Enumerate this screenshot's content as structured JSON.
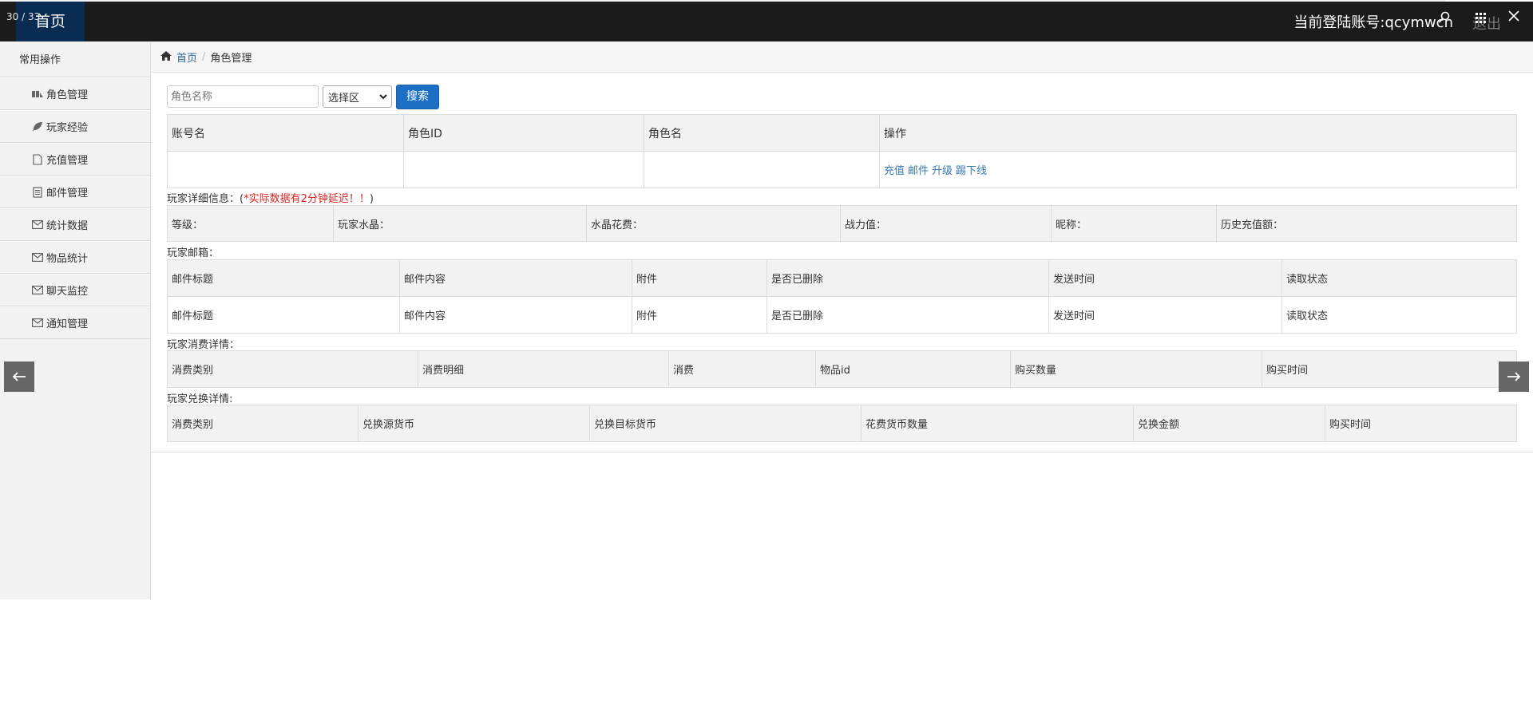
{
  "topbar": {
    "counter": "30 / 33",
    "home_tab": "首页",
    "account": "当前登陆账号:qcymwcn",
    "logout": "退出"
  },
  "sidebar": {
    "title": "常用操作",
    "items": [
      {
        "label": "角色管理",
        "icon": "users-icon"
      },
      {
        "label": "玩家经验",
        "icon": "leaf-icon"
      },
      {
        "label": "充值管理",
        "icon": "file-icon"
      },
      {
        "label": "邮件管理",
        "icon": "list-icon"
      },
      {
        "label": "统计数据",
        "icon": "envelope-icon"
      },
      {
        "label": "物品统计",
        "icon": "envelope-icon"
      },
      {
        "label": "聊天监控",
        "icon": "envelope-icon"
      },
      {
        "label": "通知管理",
        "icon": "envelope-icon"
      }
    ]
  },
  "breadcrumb": {
    "home": "首页",
    "current": "角色管理"
  },
  "search": {
    "placeholder": "角色名称",
    "select_value": "选择区",
    "button": "搜索"
  },
  "role_table": {
    "headers": [
      "账号名",
      "角色ID",
      "角色名",
      "操作"
    ],
    "actions": [
      "充值",
      "邮件",
      "升级",
      "踢下线"
    ]
  },
  "detail": {
    "label": "玩家详细信息：(",
    "warning": "*实际数据有2分钟延迟！！",
    "label_end": ")",
    "fields": [
      "等级：",
      "玩家水晶：",
      "水晶花费：",
      "战力值：",
      "昵称：",
      "历史充值额："
    ]
  },
  "mailbox": {
    "label": "玩家邮箱：",
    "headers": [
      "邮件标题",
      "邮件内容",
      "附件",
      "是否已删除",
      "发送时间",
      "读取状态"
    ],
    "row": [
      "邮件标题",
      "邮件内容",
      "附件",
      "是否已删除",
      "发送时间",
      "读取状态"
    ]
  },
  "consume": {
    "label": "玩家消费详情：",
    "headers": [
      "消费类别",
      "消费明细",
      "消费",
      "物品id",
      "购买数量",
      "购买时间"
    ]
  },
  "exchange": {
    "label": "玩家兑换详情:",
    "headers": [
      "消费类别",
      "兑换源货币",
      "兑换目标货币",
      "花费货币数量",
      "兑换金额",
      "购买时间"
    ]
  },
  "colors": {
    "topbar": "#1b1b1b",
    "home_tab": "#0a2b52",
    "button": "#1d6fc6",
    "warning": "#d9231d",
    "link": "#3a79b6"
  }
}
